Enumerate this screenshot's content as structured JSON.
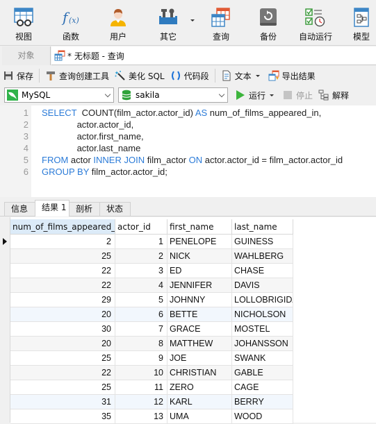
{
  "ribbon": {
    "buttons": [
      {
        "label": "视图",
        "icon": "view-icon"
      },
      {
        "label": "函数",
        "icon": "function-icon"
      },
      {
        "label": "用户",
        "icon": "user-icon"
      },
      {
        "label": "其它",
        "icon": "tools-icon"
      },
      {
        "label": "查询",
        "icon": "query-icon"
      },
      {
        "label": "备份",
        "icon": "backup-icon"
      },
      {
        "label": "自动运行",
        "icon": "schedule-icon"
      },
      {
        "label": "模型",
        "icon": "model-icon"
      }
    ]
  },
  "tabs": {
    "objects": "对象",
    "query": "* 无标题 - 查询"
  },
  "toolbar": {
    "save": "保存",
    "query_builder": "查询创建工具",
    "beautify": "美化 SQL",
    "snippet": "代码段",
    "text": "文本",
    "export": "导出结果"
  },
  "toolbar2": {
    "connection": "MySQL",
    "database": "sakila",
    "run": "运行",
    "stop": "停止",
    "explain": "解释"
  },
  "editor": {
    "lines": [
      {
        "n": "1",
        "parts": [
          {
            "t": "SELECT",
            "kw": true
          },
          {
            "t": "  COUNT(film_actor.actor_id) ",
            "kw": false
          },
          {
            "t": "AS",
            "kw": true
          },
          {
            "t": " num_of_films_appeared_in,",
            "kw": false
          }
        ]
      },
      {
        "n": "2",
        "parts": [
          {
            "t": "              actor.actor_id,",
            "kw": false
          }
        ]
      },
      {
        "n": "3",
        "parts": [
          {
            "t": "              actor.first_name,",
            "kw": false
          }
        ]
      },
      {
        "n": "4",
        "parts": [
          {
            "t": "              actor.last_name",
            "kw": false
          }
        ]
      },
      {
        "n": "5",
        "parts": [
          {
            "t": "FROM",
            "kw": true
          },
          {
            "t": " actor ",
            "kw": false
          },
          {
            "t": "INNER JOIN",
            "kw": true
          },
          {
            "t": " film_actor ",
            "kw": false
          },
          {
            "t": "ON",
            "kw": true
          },
          {
            "t": " actor.actor_id = film_actor.actor_id",
            "kw": false
          }
        ]
      },
      {
        "n": "6",
        "parts": [
          {
            "t": "GROUP BY",
            "kw": true
          },
          {
            "t": " film_actor.actor_id;",
            "kw": false
          }
        ]
      }
    ]
  },
  "result_tabs": [
    "信息",
    "结果 1",
    "剖析",
    "状态"
  ],
  "active_result_tab": 1,
  "grid": {
    "columns": [
      "num_of_films_appeared_in",
      "actor_id",
      "first_name",
      "last_name"
    ],
    "rows": [
      [
        "2",
        "1",
        "PENELOPE",
        "GUINESS"
      ],
      [
        "25",
        "2",
        "NICK",
        "WAHLBERG"
      ],
      [
        "22",
        "3",
        "ED",
        "CHASE"
      ],
      [
        "22",
        "4",
        "JENNIFER",
        "DAVIS"
      ],
      [
        "29",
        "5",
        "JOHNNY",
        "LOLLOBRIGIDA"
      ],
      [
        "20",
        "6",
        "BETTE",
        "NICHOLSON"
      ],
      [
        "30",
        "7",
        "GRACE",
        "MOSTEL"
      ],
      [
        "20",
        "8",
        "MATTHEW",
        "JOHANSSON"
      ],
      [
        "25",
        "9",
        "JOE",
        "SWANK"
      ],
      [
        "22",
        "10",
        "CHRISTIAN",
        "GABLE"
      ],
      [
        "25",
        "11",
        "ZERO",
        "CAGE"
      ],
      [
        "31",
        "12",
        "KARL",
        "BERRY"
      ],
      [
        "35",
        "13",
        "UMA",
        "WOOD"
      ]
    ],
    "current_row": 0
  },
  "colors": {
    "keyword": "#2b7bd8",
    "row_alt": "#f6f6f6",
    "row_highlight": "#f2f7fd",
    "header_selected": "#dcebf8"
  }
}
